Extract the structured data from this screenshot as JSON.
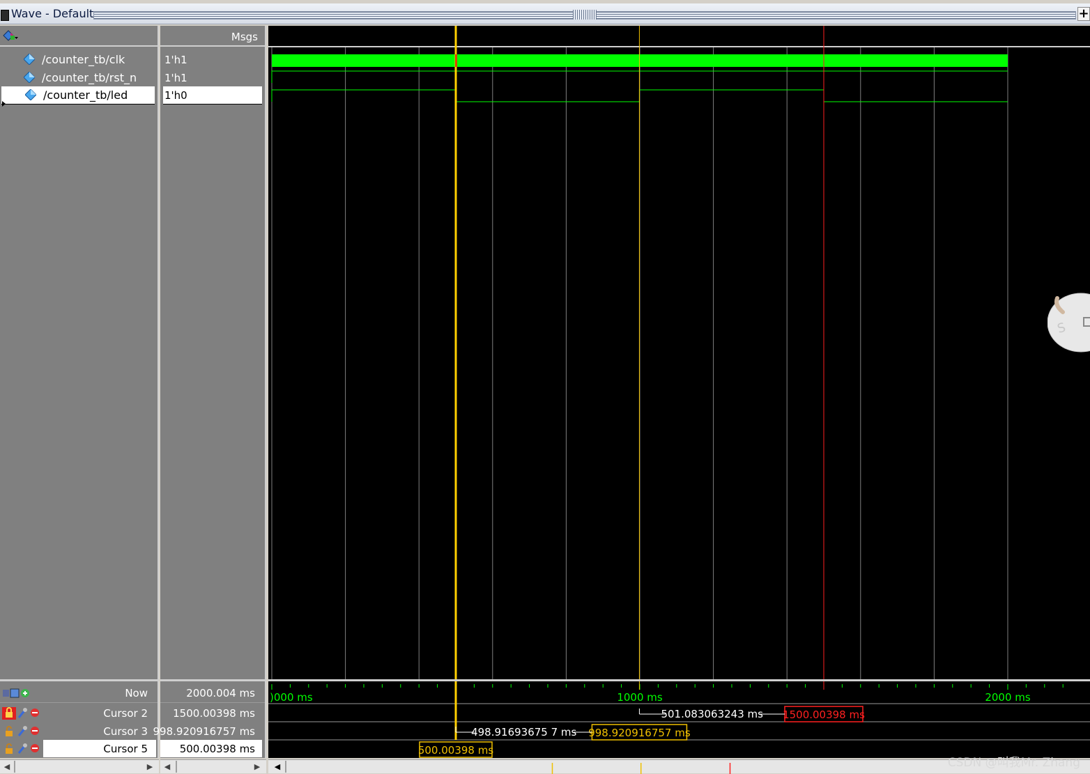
{
  "window": {
    "title": "Wave - Default",
    "maximize_glyph": "+"
  },
  "header": {
    "msgs_label": "Msgs"
  },
  "signals": [
    {
      "name": "/counter_tb/clk",
      "value": "1'h1"
    },
    {
      "name": "/counter_tb/rst_n",
      "value": "1'h1"
    },
    {
      "name": "/counter_tb/led",
      "value": "1'h0"
    }
  ],
  "timeline": {
    "range_ms": [
      0,
      2000
    ],
    "tick_labels": [
      {
        "time_ms": 0,
        "text": ")000 ms"
      },
      {
        "time_ms": 1000,
        "text": "1000 ms"
      },
      {
        "time_ms": 2000,
        "text": "2000 ms"
      }
    ]
  },
  "led_transitions_ms": [
    {
      "time_ms": 0,
      "level": 1
    },
    {
      "time_ms": 500.00398,
      "level": 0
    },
    {
      "time_ms": 998.920916757,
      "level": 1
    },
    {
      "time_ms": 1500.00398,
      "level": 0
    },
    {
      "time_ms": 2000.004,
      "level": 0
    }
  ],
  "rst_n_rise_ms": 0,
  "cursors": [
    {
      "name": "Now",
      "value": "2000.004 ms"
    },
    {
      "name": "Cursor 2",
      "value": "1500.00398 ms",
      "time_ms": 1500.00398,
      "color": "#ff2020",
      "label": "1500.00398 ms",
      "locked": true
    },
    {
      "name": "Cursor 3",
      "value": "998.920916757 ms",
      "time_ms": 998.920916757,
      "color": "#f0c000",
      "label": "998.920916757 ms",
      "locked": false
    },
    {
      "name": "Cursor 5",
      "value": "500.00398 ms",
      "time_ms": 500.00398,
      "color": "#f0c000",
      "label": "500.00398 ms",
      "locked": false,
      "selected": true
    }
  ],
  "deltas": [
    {
      "from_ms": 500.00398,
      "to_ms": 998.920916757,
      "text": "498.91693675 7 ms"
    },
    {
      "from_ms": 998.920916757,
      "to_ms": 1500.00398,
      "text": "501.083063243 ms"
    }
  ],
  "colors": {
    "signal": "#00ff00",
    "clk_fill": "#00ff00",
    "cursor_active": "#ffd000",
    "cursor_locked": "#ff2020",
    "grid": "#808080"
  },
  "watermark": "CSDN @叫我Mr. Zhang"
}
